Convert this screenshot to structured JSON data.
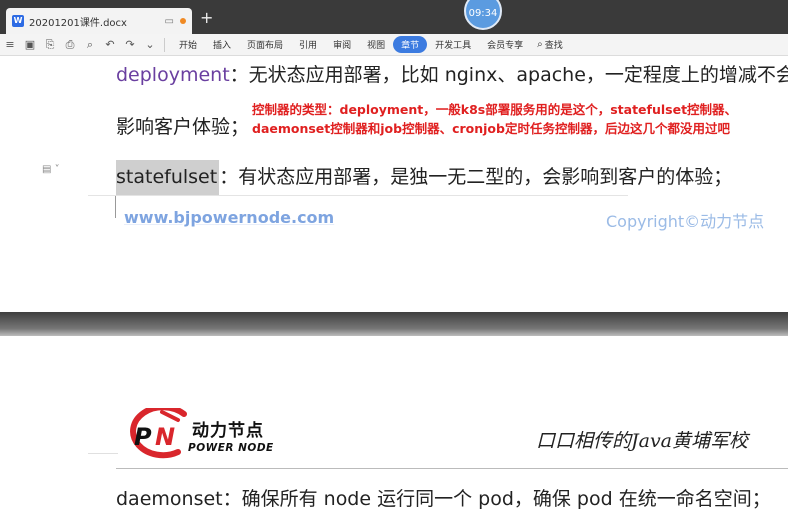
{
  "titlebar": {
    "doc_name": "20201201课件.docx",
    "clock": "09:34",
    "new_tab": "+"
  },
  "toolbar": {
    "menus": [
      "开始",
      "插入",
      "页面布局",
      "引用",
      "审阅",
      "视图",
      "章节",
      "开发工具",
      "会员专享"
    ],
    "active_menu": "章节",
    "search_label": "查找"
  },
  "page1": {
    "line1_kw": "deployment",
    "line1_rest": "：无状态应用部署，比如 nginx、apache，一定程度上的增减不会",
    "line2": "影响客户体验；",
    "annotation_1": "控制器的类型：deployment，一般k8s部署服务用的是这个，statefulset控制器、",
    "annotation_2": "daemonset控制器和job控制器、cronjob定时任务控制器，后边这几个都没用过吧",
    "line3_kw": "statefulset",
    "line3_rest": "：有状态应用部署，是独一无二型的，会影响到客户的体验；",
    "footer_link": "www.bjpowernode.com",
    "footer_copy": "Copyright©动力节点"
  },
  "page2": {
    "brand_cn": "动力节点",
    "brand_en": "POWER NODE",
    "slogan": "口口相传的Java黄埔军校",
    "line4": "daemonset：确保所有 node 运行同一个 pod，确保 pod 在统一命名空间；"
  },
  "colors": {
    "accent": "#3c7be0",
    "annotation": "#e02020",
    "keyword": "#6a3fa0",
    "logo_red": "#d9262c"
  }
}
